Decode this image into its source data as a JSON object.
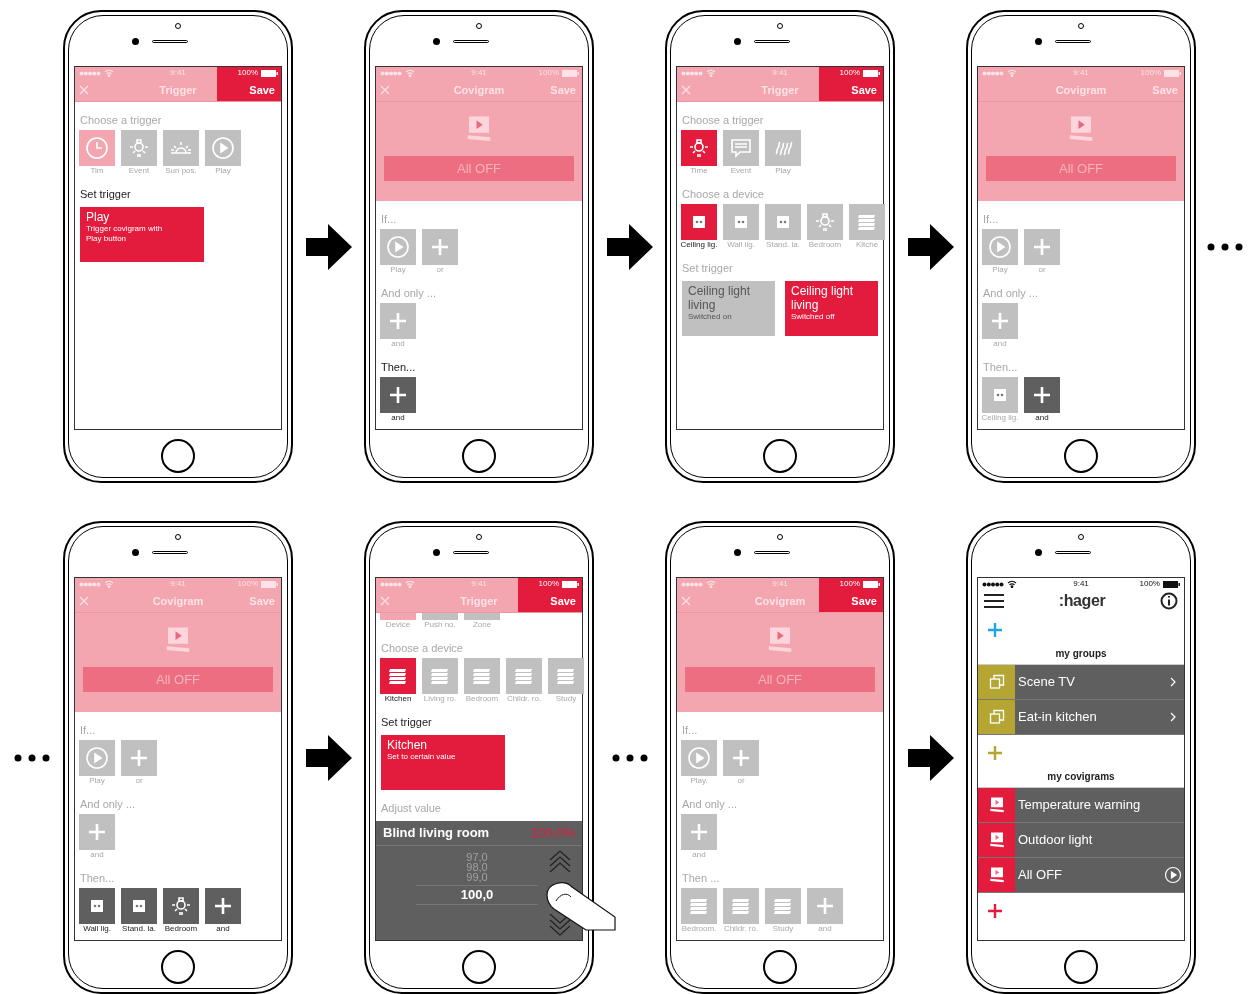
{
  "rows": [
    {
      "items": [
        {
          "kind": "spacer"
        },
        {
          "kind": "phone",
          "header": {
            "kind": "edit",
            "time": "9:41",
            "battery": "100%",
            "title": "Trigger",
            "action": "Save",
            "close": true,
            "action_active": true
          },
          "blocks": [
            {
              "kind": "heading",
              "text": "Choose a trigger",
              "strong": false
            },
            {
              "kind": "tiles",
              "items": [
                {
                  "label": "Tim",
                  "kind": "clock",
                  "color": "#f3a5b0",
                  "strong": false
                },
                {
                  "label": "Event",
                  "kind": "lamp",
                  "color": "#c0c0c0",
                  "strong": false
                },
                {
                  "label": "Sun pos.",
                  "kind": "sunrise",
                  "color": "#c0c0c0",
                  "strong": false
                },
                {
                  "label": "Play",
                  "kind": "play",
                  "color": "#c0c0c0",
                  "strong": false
                }
              ]
            },
            {
              "kind": "heading",
              "text": "Set trigger",
              "strong": true
            },
            {
              "kind": "cards",
              "items": [
                {
                  "title": "Play",
                  "subtitle": "Trigger covigram with Play button",
                  "selected": true
                }
              ]
            }
          ]
        },
        {
          "kind": "arrow"
        },
        {
          "kind": "phone",
          "header": {
            "kind": "edit",
            "time": "9:41",
            "battery": "100%",
            "title": "Covigram",
            "action": "Save",
            "close": true,
            "action_active": false
          },
          "blocks": [
            {
              "kind": "hero",
              "button": "All OFF"
            },
            {
              "kind": "heading",
              "text": "If...",
              "strong": false
            },
            {
              "kind": "tiles",
              "items": [
                {
                  "label": "Play",
                  "kind": "play",
                  "color": "#c0c0c0",
                  "strong": false
                },
                {
                  "label": "or",
                  "kind": "plus",
                  "color": "#c0c0c0",
                  "strong": false
                }
              ]
            },
            {
              "kind": "heading",
              "text": "And only ...",
              "strong": false
            },
            {
              "kind": "tiles",
              "items": [
                {
                  "label": "and",
                  "kind": "plus",
                  "color": "#c0c0c0",
                  "strong": false
                }
              ]
            },
            {
              "kind": "heading",
              "text": "Then...",
              "strong": true
            },
            {
              "kind": "tiles",
              "items": [
                {
                  "label": "and",
                  "kind": "plus",
                  "color": "#5f5f5f",
                  "strong": true
                }
              ]
            }
          ]
        },
        {
          "kind": "arrow"
        },
        {
          "kind": "phone",
          "header": {
            "kind": "edit",
            "time": "9:41",
            "battery": "100%",
            "title": "Trigger",
            "action": "Save",
            "close": true,
            "action_active": true
          },
          "blocks": [
            {
              "kind": "heading",
              "text": "Choose a trigger",
              "strong": false
            },
            {
              "kind": "tiles",
              "items": [
                {
                  "label": "Time",
                  "kind": "lamp",
                  "color": "#e31c3d",
                  "strong": false
                },
                {
                  "label": "Event",
                  "kind": "message",
                  "color": "#c0c0c0",
                  "strong": false
                },
                {
                  "label": "Play",
                  "kind": "waves",
                  "color": "#c0c0c0",
                  "strong": false
                }
              ]
            },
            {
              "kind": "heading",
              "text": "Choose a device",
              "strong": false
            },
            {
              "kind": "tiles",
              "items": [
                {
                  "label": "Ceiling lig.",
                  "kind": "socket",
                  "color": "#e31c3d",
                  "strong": true
                },
                {
                  "label": "Wall lig.",
                  "kind": "socket",
                  "color": "#c0c0c0",
                  "strong": false
                },
                {
                  "label": "Stand. la.",
                  "kind": "socket",
                  "color": "#c0c0c0",
                  "strong": false
                },
                {
                  "label": "Bedroom",
                  "kind": "lamp",
                  "color": "#c0c0c0",
                  "strong": false
                },
                {
                  "label": "Kitche",
                  "kind": "blinds",
                  "color": "#c0c0c0",
                  "strong": false
                }
              ]
            },
            {
              "kind": "heading",
              "text": "Set trigger",
              "strong": false
            },
            {
              "kind": "cards",
              "items": [
                {
                  "title": "Ceiling light living",
                  "subtitle": "Switched on",
                  "selected": false
                },
                {
                  "title": "Ceiling light living",
                  "subtitle": "Switched off",
                  "selected": true
                }
              ]
            }
          ]
        },
        {
          "kind": "arrow"
        },
        {
          "kind": "phone",
          "header": {
            "kind": "edit",
            "time": "9:41",
            "battery": "100%",
            "title": "Covigram",
            "action": "Save",
            "close": false,
            "action_active": false
          },
          "blocks": [
            {
              "kind": "hero",
              "button": "All OFF"
            },
            {
              "kind": "heading",
              "text": "If...",
              "strong": false
            },
            {
              "kind": "tiles",
              "items": [
                {
                  "label": "Play",
                  "kind": "play",
                  "color": "#c0c0c0",
                  "strong": false
                },
                {
                  "label": "or",
                  "kind": "plus",
                  "color": "#c0c0c0",
                  "strong": false
                }
              ]
            },
            {
              "kind": "heading",
              "text": "And only ...",
              "strong": false
            },
            {
              "kind": "tiles",
              "items": [
                {
                  "label": "and",
                  "kind": "plus",
                  "color": "#c0c0c0",
                  "strong": false
                }
              ]
            },
            {
              "kind": "heading",
              "text": "Then...",
              "strong": false
            },
            {
              "kind": "tiles",
              "items": [
                {
                  "label": "Ceiling lig.",
                  "kind": "socket",
                  "color": "#c0c0c0",
                  "strong": false
                },
                {
                  "label": "and",
                  "kind": "plus",
                  "color": "#5f5f5f",
                  "strong": true
                }
              ]
            }
          ]
        },
        {
          "kind": "ellipsis"
        }
      ]
    },
    {
      "items": [
        {
          "kind": "ellipsis"
        },
        {
          "kind": "phone",
          "header": {
            "kind": "edit",
            "time": "9:41",
            "battery": "100%",
            "title": "Covigram",
            "action": "Save",
            "close": true,
            "action_active": false
          },
          "blocks": [
            {
              "kind": "hero",
              "button": "All OFF"
            },
            {
              "kind": "heading",
              "text": "If...",
              "strong": false
            },
            {
              "kind": "tiles",
              "items": [
                {
                  "label": "Play",
                  "kind": "play",
                  "color": "#c0c0c0",
                  "strong": false
                },
                {
                  "label": "or",
                  "kind": "plus",
                  "color": "#c0c0c0",
                  "strong": false
                }
              ]
            },
            {
              "kind": "heading",
              "text": "And only ...",
              "strong": false
            },
            {
              "kind": "tiles",
              "items": [
                {
                  "label": "and",
                  "kind": "plus",
                  "color": "#c0c0c0",
                  "strong": false
                }
              ]
            },
            {
              "kind": "heading",
              "text": "Then...",
              "strong": false
            },
            {
              "kind": "tiles",
              "items": [
                {
                  "label": "Wall lig.",
                  "kind": "socket",
                  "color": "#5f5f5f",
                  "strong": true
                },
                {
                  "label": "Stand. la.",
                  "kind": "socket",
                  "color": "#5f5f5f",
                  "strong": true
                },
                {
                  "label": "Bedroom",
                  "kind": "lamp",
                  "color": "#5f5f5f",
                  "strong": true
                },
                {
                  "label": "and",
                  "kind": "plus",
                  "color": "#5f5f5f",
                  "strong": true
                }
              ]
            }
          ]
        },
        {
          "kind": "arrow"
        },
        {
          "kind": "phone",
          "header": {
            "kind": "edit",
            "time": "9:41",
            "battery": "100%",
            "title": "Trigger",
            "action": "Save",
            "close": true,
            "action_active": true
          },
          "blocks": [
            {
              "kind": "tiles",
              "clipped": true,
              "items": [
                {
                  "label": "Device",
                  "color": "#f3a5b0",
                  "strong": false
                },
                {
                  "label": "Push no.",
                  "color": "#c0c0c0",
                  "strong": false
                },
                {
                  "label": "Zone",
                  "color": "#c0c0c0",
                  "strong": false
                }
              ]
            },
            {
              "kind": "heading",
              "text": "Choose a device",
              "strong": false
            },
            {
              "kind": "tiles",
              "items": [
                {
                  "label": "Kitchen",
                  "kind": "blinds",
                  "color": "#e31c3d",
                  "strong": true
                },
                {
                  "label": "Living ro.",
                  "kind": "blinds",
                  "color": "#c0c0c0",
                  "strong": false
                },
                {
                  "label": "Bedroom",
                  "kind": "blinds",
                  "color": "#c0c0c0",
                  "strong": false
                },
                {
                  "label": "Childr. ro.",
                  "kind": "blinds",
                  "color": "#c0c0c0",
                  "strong": false
                },
                {
                  "label": "Study",
                  "kind": "blinds",
                  "color": "#c0c0c0",
                  "strong": false
                }
              ]
            },
            {
              "kind": "heading",
              "text": "Set trigger",
              "strong": true
            },
            {
              "kind": "cards",
              "items": [
                {
                  "title": "Kitchen",
                  "subtitle": "Set to certain value",
                  "selected": true
                }
              ]
            },
            {
              "kind": "heading",
              "text": "Adjust value",
              "strong": false
            },
            {
              "kind": "picker",
              "title": "Blind living room",
              "reading": "100,0%",
              "values": [
                "97,0",
                "98,0",
                "99,0"
              ],
              "current": "100,0"
            }
          ]
        },
        {
          "kind": "ellipsis"
        },
        {
          "kind": "phone",
          "header": {
            "kind": "edit",
            "time": "9:41",
            "battery": "100%",
            "title": "Covigram",
            "action": "Save",
            "close": true,
            "action_active": true
          },
          "blocks": [
            {
              "kind": "hero",
              "button": "All OFF"
            },
            {
              "kind": "heading",
              "text": "If...",
              "strong": false
            },
            {
              "kind": "tiles",
              "items": [
                {
                  "label": "Play.",
                  "kind": "play",
                  "color": "#c0c0c0",
                  "strong": false
                },
                {
                  "label": "or",
                  "kind": "plus",
                  "color": "#c0c0c0",
                  "strong": false
                }
              ]
            },
            {
              "kind": "heading",
              "text": "And only ...",
              "strong": false
            },
            {
              "kind": "tiles",
              "items": [
                {
                  "label": "and",
                  "kind": "plus",
                  "color": "#c0c0c0",
                  "strong": false
                }
              ]
            },
            {
              "kind": "heading",
              "text": "Then ...",
              "strong": false
            },
            {
              "kind": "tiles",
              "items": [
                {
                  "label": "Bedroom.",
                  "kind": "blinds",
                  "color": "#c0c0c0",
                  "strong": false
                },
                {
                  "label": "Childr. ro.",
                  "kind": "blinds",
                  "color": "#c0c0c0",
                  "strong": false
                },
                {
                  "label": "Study",
                  "kind": "blinds",
                  "color": "#c0c0c0",
                  "strong": false
                },
                {
                  "label": "and",
                  "kind": "plus",
                  "color": "#c0c0c0",
                  "strong": false
                }
              ]
            }
          ]
        },
        {
          "kind": "arrow"
        },
        {
          "kind": "phone",
          "header": {
            "kind": "home",
            "time": "9:41",
            "battery": "100%",
            "logo": ":hager"
          },
          "blocks": [
            {
              "kind": "add",
              "color": "#1ea5e0"
            },
            {
              "kind": "section",
              "text": "my groups"
            },
            {
              "kind": "group_row",
              "label": "Scene TV",
              "color": "#b5a633"
            },
            {
              "kind": "group_row",
              "label": "Eat-in kitchen",
              "color": "#b5a633"
            },
            {
              "kind": "add",
              "color": "#b5a633"
            },
            {
              "kind": "section",
              "text": "my covigrams"
            },
            {
              "kind": "covigram_row",
              "label": "Temperature warning",
              "color": "#e31c3d"
            },
            {
              "kind": "covigram_row",
              "label": "Outdoor light",
              "color": "#e31c3d"
            },
            {
              "kind": "covigram_play_row",
              "label": "All OFF",
              "color": "#e31c3d"
            },
            {
              "kind": "add",
              "color": "#e31c3d"
            }
          ]
        },
        {
          "kind": "spacer"
        }
      ]
    }
  ]
}
